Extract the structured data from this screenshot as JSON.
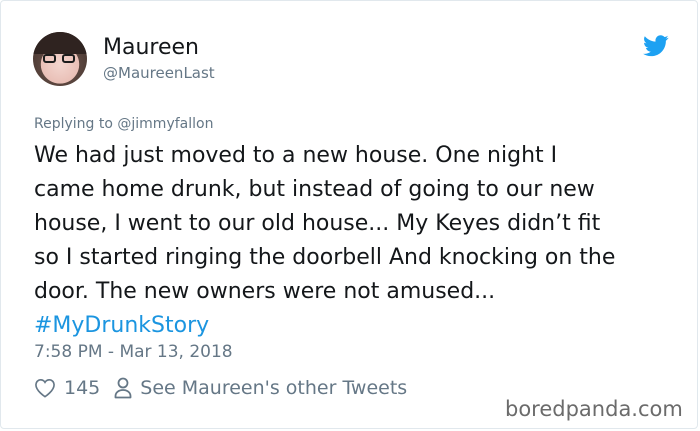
{
  "user": {
    "name": "Maureen",
    "handle": "@MaureenLast"
  },
  "reply": {
    "prefix": "Replying to ",
    "target": "@jimmyfallon"
  },
  "tweet": {
    "lines": [
      "We had just moved to a new house. One night I",
      "came home drunk, but instead of going to our new",
      "house, I went to our old house... My Keyes didn’t fit",
      "so I started ringing the doorbell And knocking on the",
      "door. The new owners were not amused..."
    ],
    "hashtag": "#MyDrunkStory",
    "timestamp": "7:58 PM - Mar 13, 2018"
  },
  "actions": {
    "likes": "145",
    "other_tweets": "See Maureen's other Tweets"
  },
  "watermark": "boredpanda.com",
  "colors": {
    "link": "#1b95e0",
    "muted": "#657786",
    "twitter_blue": "#1da1f2"
  },
  "icons": [
    "twitter-bird-icon",
    "heart-icon",
    "person-icon"
  ]
}
